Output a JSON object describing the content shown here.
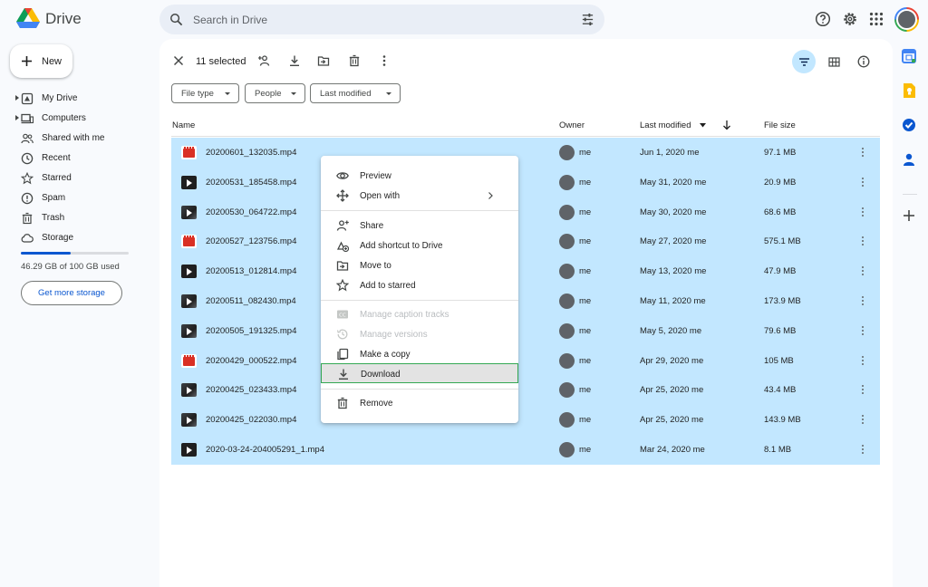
{
  "app": {
    "name": "Drive"
  },
  "search": {
    "placeholder": "Search in Drive"
  },
  "sidebar": {
    "new_label": "New",
    "items": [
      {
        "label": "My Drive",
        "icon": "my-drive-icon",
        "expandable": true
      },
      {
        "label": "Computers",
        "icon": "computers-icon",
        "expandable": true
      },
      {
        "label": "Shared with me",
        "icon": "shared-icon",
        "expandable": false
      },
      {
        "label": "Recent",
        "icon": "clock-icon",
        "expandable": false
      },
      {
        "label": "Starred",
        "icon": "star-icon",
        "expandable": false
      },
      {
        "label": "Spam",
        "icon": "spam-icon",
        "expandable": false
      },
      {
        "label": "Trash",
        "icon": "trash-icon",
        "expandable": false
      },
      {
        "label": "Storage",
        "icon": "cloud-icon",
        "expandable": false
      }
    ],
    "storage_text": "46.29 GB of 100 GB used",
    "storage_used_fraction": 0.4629,
    "get_storage_label": "Get more storage"
  },
  "selection": {
    "count_label": "11 selected"
  },
  "filters": [
    {
      "label": "File type"
    },
    {
      "label": "People"
    },
    {
      "label": "Last modified"
    }
  ],
  "table": {
    "headers": {
      "name": "Name",
      "owner": "Owner",
      "modified": "Last modified",
      "size": "File size"
    },
    "rows": [
      {
        "name": "20200601_132035.mp4",
        "icon": "clip",
        "owner": "me",
        "modified": "Jun 1, 2020 me",
        "size": "97.1 MB"
      },
      {
        "name": "20200531_185458.mp4",
        "icon": "video",
        "owner": "me",
        "modified": "May 31, 2020 me",
        "size": "20.9 MB"
      },
      {
        "name": "20200530_064722.mp4",
        "icon": "thumb",
        "owner": "me",
        "modified": "May 30, 2020 me",
        "size": "68.6 MB"
      },
      {
        "name": "20200527_123756.mp4",
        "icon": "clip",
        "owner": "me",
        "modified": "May 27, 2020 me",
        "size": "575.1 MB"
      },
      {
        "name": "20200513_012814.mp4",
        "icon": "video",
        "owner": "me",
        "modified": "May 13, 2020 me",
        "size": "47.9 MB"
      },
      {
        "name": "20200511_082430.mp4",
        "icon": "thumb",
        "owner": "me",
        "modified": "May 11, 2020 me",
        "size": "173.9 MB"
      },
      {
        "name": "20200505_191325.mp4",
        "icon": "thumb",
        "owner": "me",
        "modified": "May 5, 2020 me",
        "size": "79.6 MB"
      },
      {
        "name": "20200429_000522.mp4",
        "icon": "clip",
        "owner": "me",
        "modified": "Apr 29, 2020 me",
        "size": "105 MB"
      },
      {
        "name": "20200425_023433.mp4",
        "icon": "thumb",
        "owner": "me",
        "modified": "Apr 25, 2020 me",
        "size": "43.4 MB"
      },
      {
        "name": "20200425_022030.mp4",
        "icon": "thumb",
        "owner": "me",
        "modified": "Apr 25, 2020 me",
        "size": "143.9 MB"
      },
      {
        "name": "2020-03-24-204005291_1.mp4",
        "icon": "video",
        "owner": "me",
        "modified": "Mar 24, 2020 me",
        "size": "8.1 MB"
      }
    ]
  },
  "context_menu": {
    "items": [
      {
        "label": "Preview",
        "icon": "eye-icon",
        "disabled": false
      },
      {
        "label": "Open with",
        "icon": "open-with-icon",
        "disabled": false,
        "submenu": true
      },
      {
        "label": "Share",
        "icon": "person-add-icon",
        "disabled": false
      },
      {
        "label": "Add shortcut to Drive",
        "icon": "add-shortcut-icon",
        "disabled": false
      },
      {
        "label": "Move to",
        "icon": "move-to-icon",
        "disabled": false
      },
      {
        "label": "Add to starred",
        "icon": "star-icon",
        "disabled": false
      },
      {
        "label": "Manage caption tracks",
        "icon": "cc-icon",
        "disabled": true
      },
      {
        "label": "Manage versions",
        "icon": "history-icon",
        "disabled": true
      },
      {
        "label": "Make a copy",
        "icon": "copy-icon",
        "disabled": false
      },
      {
        "label": "Download",
        "icon": "download-icon",
        "disabled": false,
        "highlighted": true
      },
      {
        "label": "Remove",
        "icon": "trash-icon",
        "disabled": false
      }
    ]
  },
  "colors": {
    "selection_bg": "#c2e7ff",
    "accent": "#0b57d0",
    "highlight_border": "#34a853"
  }
}
